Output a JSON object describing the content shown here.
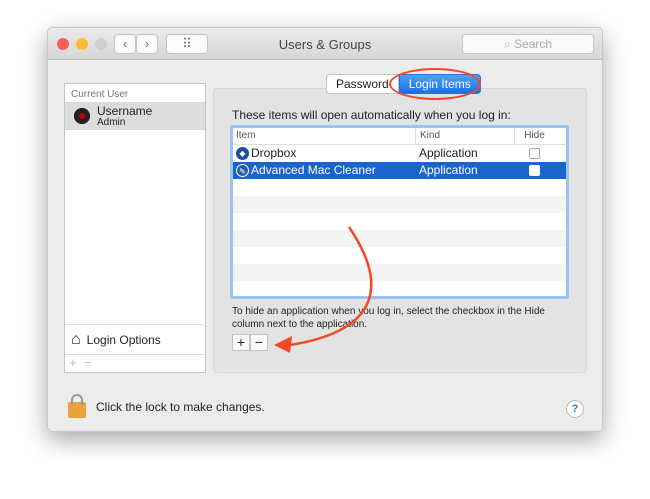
{
  "window": {
    "title": "Users & Groups",
    "search_placeholder": "Search",
    "back": "‹",
    "forward": "›",
    "grid": "⠿"
  },
  "sidebar": {
    "section": "Current User",
    "user": {
      "name": "Username",
      "role": "Admin"
    },
    "login_options": "Login Options",
    "add": "+",
    "remove": "−"
  },
  "tabs": [
    {
      "label": "Password",
      "active": false
    },
    {
      "label": "Login Items",
      "active": true
    }
  ],
  "intro": "These items will open automatically when you log in:",
  "table": {
    "columns": [
      "Item",
      "Kind",
      "Hide"
    ],
    "rows": [
      {
        "item": "Dropbox",
        "kind": "Application",
        "hide": false,
        "selected": false,
        "icon": "dropbox-icon"
      },
      {
        "item": "Advanced Mac Cleaner",
        "kind": "Application",
        "hide": false,
        "selected": true,
        "icon": "advanced-mac-cleaner-icon"
      }
    ]
  },
  "hint": "To hide an application when you log in, select the checkbox in the Hide column next to the application.",
  "buttons": {
    "add": "+",
    "remove": "−"
  },
  "lock_text": "Click the lock to make changes.",
  "help": "?",
  "colors": {
    "accent": "#1a64d0",
    "annotation": "#f04a25"
  }
}
